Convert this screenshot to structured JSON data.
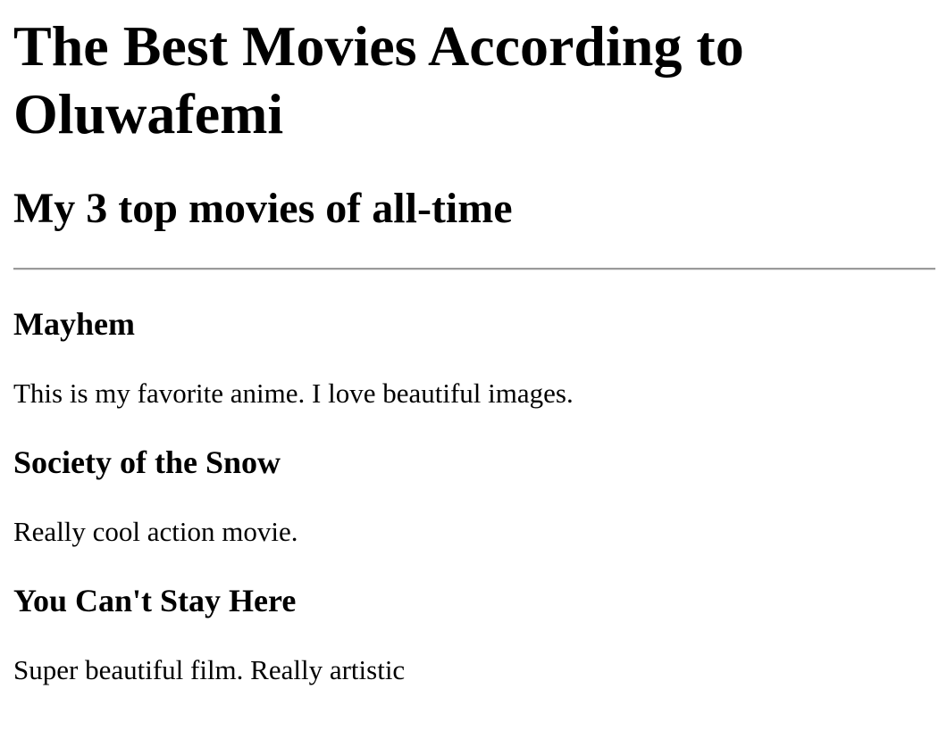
{
  "page": {
    "title": "The Best Movies According to Oluwafemi",
    "subtitle": "My 3 top movies of all-time"
  },
  "movies": [
    {
      "title": "Mayhem",
      "description": "This is my favorite anime. I love beautiful images."
    },
    {
      "title": "Society of the Snow",
      "description": "Really cool action movie."
    },
    {
      "title": "You Can't Stay Here",
      "description": "Super beautiful film. Really artistic"
    }
  ],
  "colors": {
    "text": "#000000",
    "background": "#ffffff",
    "divider": "#9a9a9a"
  }
}
